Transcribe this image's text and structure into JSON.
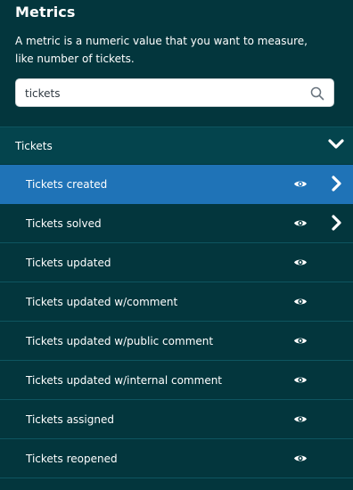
{
  "header": {
    "title": "Metrics",
    "description": "A metric is a numeric value that you want to measure, like number of tickets."
  },
  "search": {
    "value": "tickets",
    "icon": "search-icon"
  },
  "section": {
    "label": "Tickets",
    "icon": "chevron-down-icon",
    "expanded": true
  },
  "items": [
    {
      "label": "Tickets created",
      "selected": true,
      "has_submenu": true
    },
    {
      "label": "Tickets solved",
      "selected": false,
      "has_submenu": true
    },
    {
      "label": "Tickets updated",
      "selected": false,
      "has_submenu": false
    },
    {
      "label": "Tickets updated w/comment",
      "selected": false,
      "has_submenu": false
    },
    {
      "label": "Tickets updated w/public comment",
      "selected": false,
      "has_submenu": false
    },
    {
      "label": "Tickets updated w/internal comment",
      "selected": false,
      "has_submenu": false
    },
    {
      "label": "Tickets assigned",
      "selected": false,
      "has_submenu": false
    },
    {
      "label": "Tickets reopened",
      "selected": false,
      "has_submenu": false
    }
  ],
  "colors": {
    "background": "#03363d",
    "section_background": "#04444d",
    "selected": "#1f73b7",
    "divider": "#0e5560"
  }
}
